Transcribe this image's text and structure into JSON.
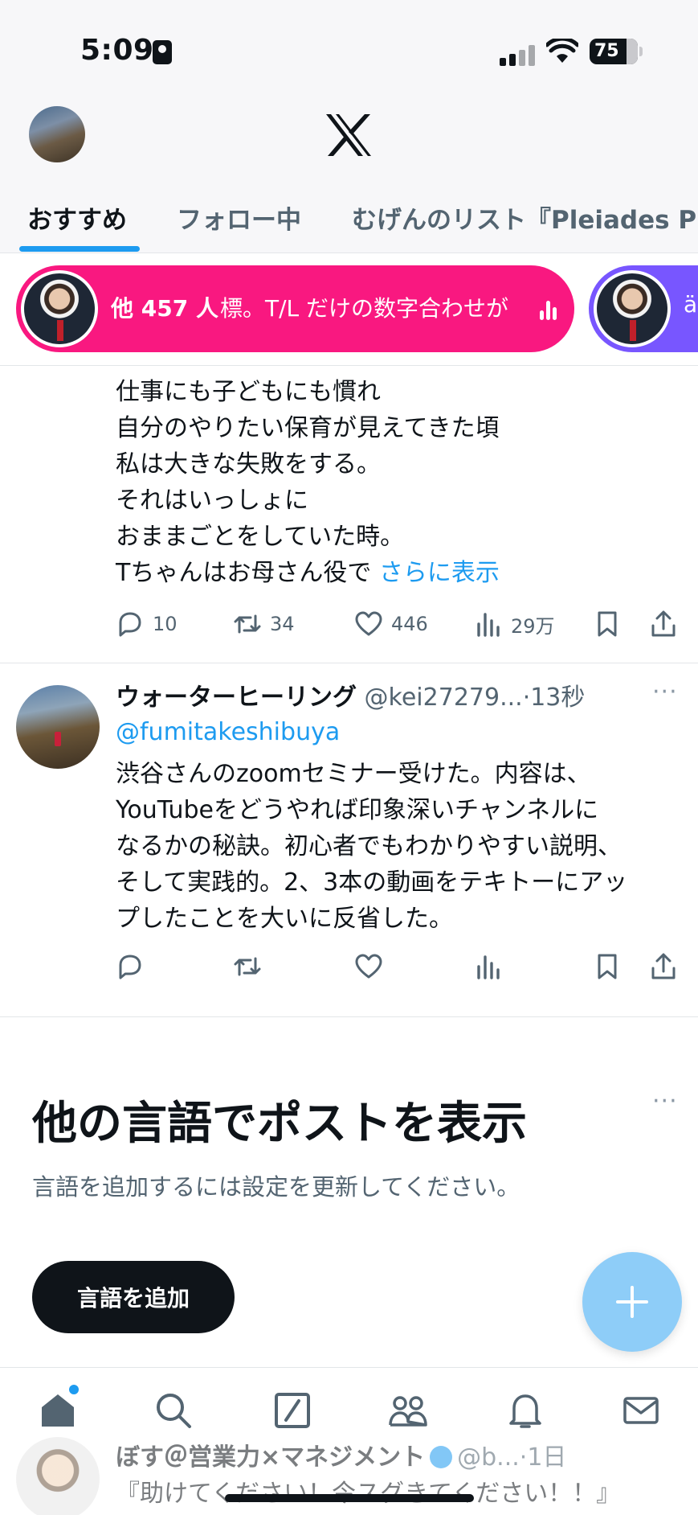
{
  "status_bar": {
    "time": "5:09",
    "battery": "75"
  },
  "header": {
    "logo": "X"
  },
  "tabs": [
    {
      "label": "おすすめ"
    },
    {
      "label": "フォロー中"
    },
    {
      "label": "むげんのリスト『Pleiades P"
    }
  ],
  "spaces": {
    "live_count": "他 457 人",
    "snippet": "標。T/L だけの数字合わせが",
    "second_snippet": "ä"
  },
  "tweet1": {
    "lines": [
      "仕事にも子どもにも慣れ",
      "自分のやりたい保育が見えてきた頃",
      "私は大きな失敗をする。",
      "それはいっしょに",
      "おままごとをしていた時。",
      "Tちゃんはお母さん役で"
    ],
    "show_more": "さらに表示",
    "replies": "10",
    "reposts": "34",
    "likes": "446",
    "views": "29万"
  },
  "tweet2": {
    "name": "ウォーターヒーリング",
    "handle": "@kei27279...",
    "time": "·13秒",
    "mention": "@fumitakeshibuya",
    "lines": [
      "渋谷さんのzoomセミナー受けた。内容は、",
      "YouTubeをどうやれば印象深いチャンネルに",
      "なるかの秘訣。初心者でもわかりやすい説明、",
      "そして実践的。2、3本の動画をテキトーにアッ",
      "プしたことを大いに反省した。"
    ]
  },
  "language_prompt": {
    "title": "他の言語でポストを表示",
    "description": "言語を追加するには設定を更新してください。",
    "button": "言語を追加"
  },
  "tweet3": {
    "name": "ぼす＠営業力×マネジメント",
    "handle": "@b...",
    "time": "·1日",
    "line1": "『助けてください！今スグきてください！！』"
  },
  "colors": {
    "accent": "#1d9bf0",
    "spaces_pink": "#f91880",
    "spaces_purple": "#7856ff",
    "text": "#0f1419",
    "muted": "#536471"
  }
}
